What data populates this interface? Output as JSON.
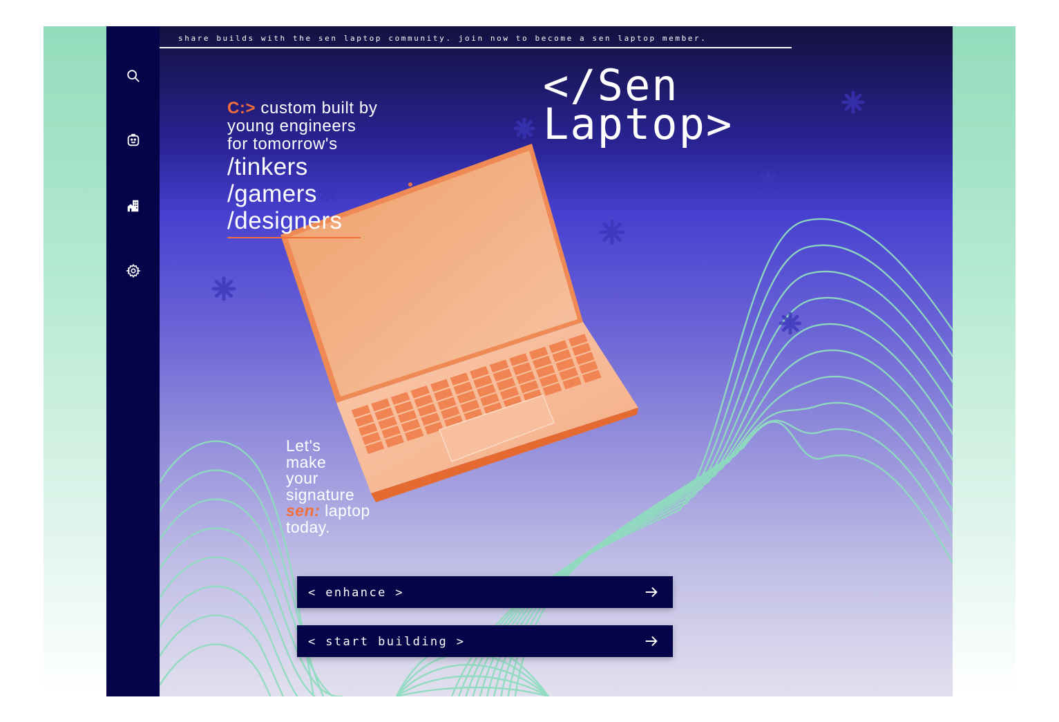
{
  "topbar": {
    "announcement": "share builds with the sen laptop community. join now to become a sen laptop member."
  },
  "sidebar": {
    "items": [
      {
        "icon": "search-icon"
      },
      {
        "icon": "smiley-badge-icon"
      },
      {
        "icon": "building-icon"
      },
      {
        "icon": "gear-icon"
      }
    ]
  },
  "brand": {
    "line1": "</Sen",
    "line2": "Laptop>"
  },
  "hero": {
    "prompt": "C:>",
    "line1": " custom built by",
    "line2": "young engineers",
    "line3": "for tomorrow's",
    "audiences": [
      "/tinkers",
      "/gamers",
      "/designers"
    ]
  },
  "tagline": {
    "line1": "Let's",
    "line2": "make",
    "line3": "your",
    "line4": "signature",
    "accent": "sen:",
    "line5_rest": " laptop",
    "line6": "today."
  },
  "buttons": {
    "enhance": "< enhance >",
    "start_building": "< start building >"
  },
  "colors": {
    "sidebar": "#060449",
    "accent_orange": "#f26f3a",
    "wave_green": "#8fdcbf",
    "outer_mint": "#93dcbc"
  }
}
